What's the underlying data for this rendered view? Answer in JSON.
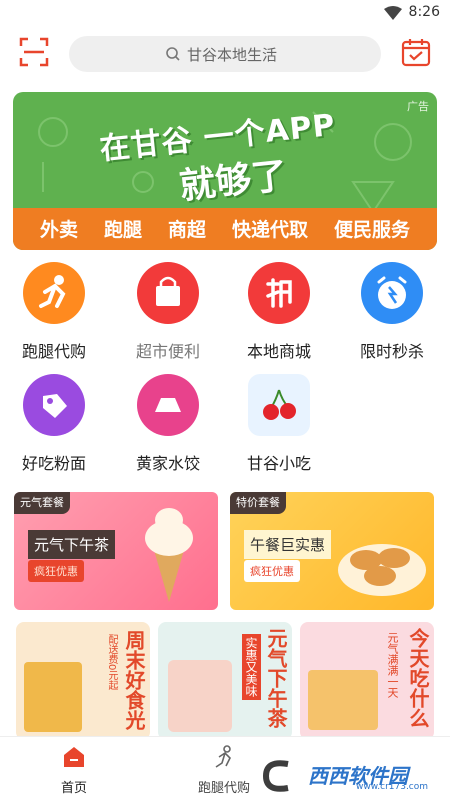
{
  "status": {
    "time": "8:26"
  },
  "search": {
    "placeholder": "甘谷本地生活"
  },
  "banner": {
    "headline": "在甘谷 一个APP",
    "subheadline": "就够了",
    "ad_label": "广告",
    "tags": [
      "外卖",
      "跑腿",
      "商超",
      "快递代取",
      "便民服务"
    ]
  },
  "services": [
    {
      "label": "跑腿代购",
      "icon": "runner-icon",
      "color": "#ff8a1f"
    },
    {
      "label": "超市便利",
      "icon": "shopping-bag-icon",
      "color": "#f23a3a"
    },
    {
      "label": "本地商城",
      "icon": "grab-icon",
      "color": "#f23a3a"
    },
    {
      "label": "限时秒杀",
      "icon": "alarm-clock-icon",
      "color": "#2f8df5"
    },
    {
      "label": "好吃粉面",
      "icon": "tag-icon",
      "color": "#9a4be0"
    },
    {
      "label": "黄家水饺",
      "icon": "tray-icon",
      "color": "#e8428c"
    },
    {
      "label": "甘谷小吃",
      "icon": "cherry-icon",
      "color": "#e8f3ff"
    }
  ],
  "promos": [
    {
      "tag": "元气套餐",
      "title": "元气下午茶",
      "badge": "疯狂优惠"
    },
    {
      "tag": "特价套餐",
      "title": "午餐巨实惠",
      "badge": "疯狂优惠"
    }
  ],
  "cards": [
    {
      "title": "周末好食光",
      "small": "配送费0元起"
    },
    {
      "title": "元气下午茶",
      "small": "实惠又美味"
    },
    {
      "title": "今天吃什么",
      "small": "元气满满一天"
    }
  ],
  "tabs": [
    {
      "label": "首页"
    },
    {
      "label": "跑腿代购"
    }
  ],
  "watermark": {
    "text": "西西软件园",
    "url": "www.cr173.com"
  },
  "colors": {
    "accent": "#e8452c",
    "banner_green": "#5fb14f",
    "banner_orange": "#ef7d22"
  }
}
